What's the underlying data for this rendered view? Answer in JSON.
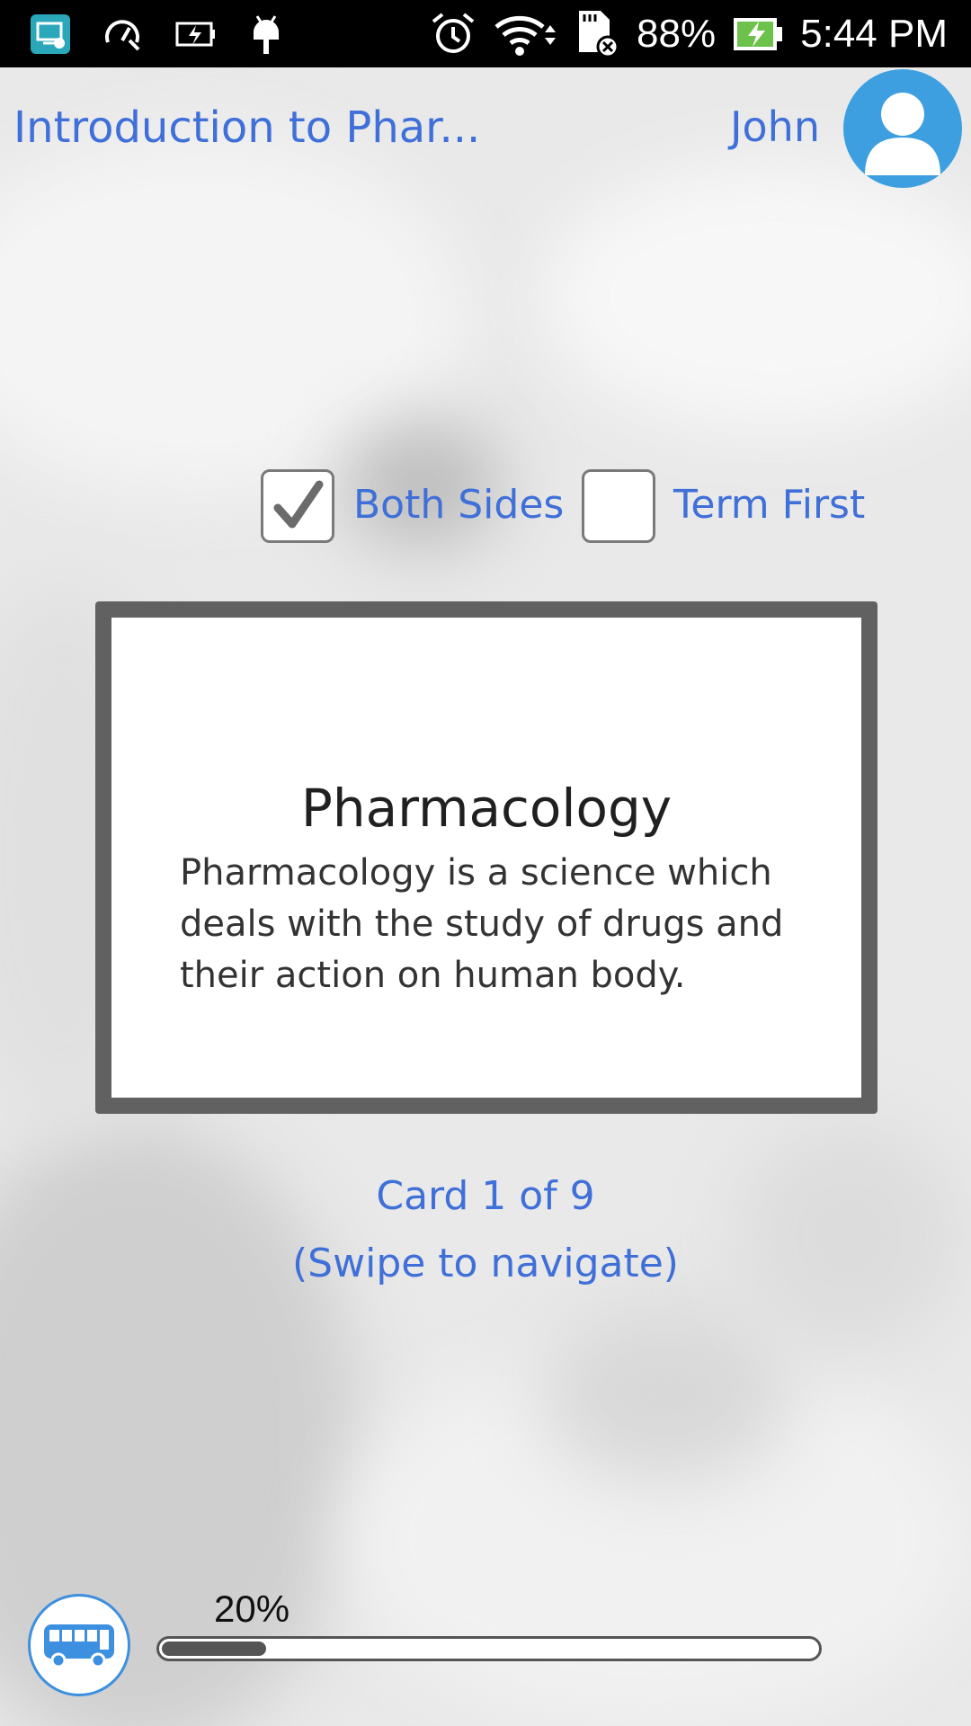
{
  "status_bar": {
    "battery_percent": "88%",
    "time": "5:44 PM",
    "icons": [
      "screen-mirror-icon",
      "speed-boost-icon",
      "battery-saver-icon",
      "android-debug-icon",
      "alarm-icon",
      "wifi-icon",
      "sd-card-error-icon",
      "battery-charging-icon"
    ]
  },
  "header": {
    "course_title": "Introduction to Phar...",
    "user_name": "John",
    "avatar_icon": "user-avatar-icon"
  },
  "options": {
    "both_sides": {
      "label": "Both Sides",
      "checked": true
    },
    "term_first": {
      "label": "Term First",
      "checked": false
    }
  },
  "card": {
    "term": "Pharmacology",
    "definition": "Pharmacology is a science which deals with the study of drugs and their action on human body."
  },
  "navigation": {
    "card_count": "Card 1 of 9",
    "hint": "(Swipe to navigate)"
  },
  "progress": {
    "label": "20%",
    "value": 0.2,
    "icon": "bus-icon"
  },
  "colors": {
    "accent": "#3f6fd8",
    "avatar": "#3d9fe0",
    "card_border": "#616161"
  }
}
